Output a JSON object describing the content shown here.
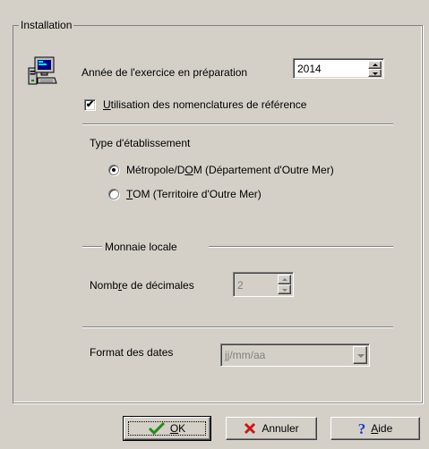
{
  "group": {
    "title": "Installation"
  },
  "icon": {
    "name": "computer-icon"
  },
  "year": {
    "label_before": "Année de l'exercice en préparation",
    "value": "2014"
  },
  "nomenclature": {
    "label_underlined": "U",
    "label_rest": "tilisation des nomenclatures de référence",
    "checked": true,
    "check_mark": "✔"
  },
  "etablissement": {
    "title": "Type d'établissement",
    "options": [
      {
        "before": "Métropole/D",
        "underlined": "O",
        "after": "M (Département d'Outre Mer)",
        "selected": true
      },
      {
        "before": "",
        "underlined": "T",
        "after": "OM (Territoire d'Outre Mer)",
        "selected": false
      }
    ]
  },
  "monnaie": {
    "title": "Monnaie locale",
    "decimals_before": "Nomb",
    "decimals_underlined": "r",
    "decimals_after": "e de décimales",
    "decimals_value": "2"
  },
  "dates": {
    "label": "Format des dates",
    "value": "jj/mm/aa"
  },
  "buttons": {
    "ok": {
      "label": "OK",
      "underlined": "O",
      "rest": "K"
    },
    "annuler": {
      "label": "Annuler"
    },
    "aide": {
      "underlined": "A",
      "rest": "ide"
    }
  },
  "colors": {
    "face": "#d4d0c8",
    "shadow": "#808080",
    "ok_green": "#2a8a1a",
    "cancel_red": "#c81818",
    "help_blue": "#1a3ccc"
  }
}
